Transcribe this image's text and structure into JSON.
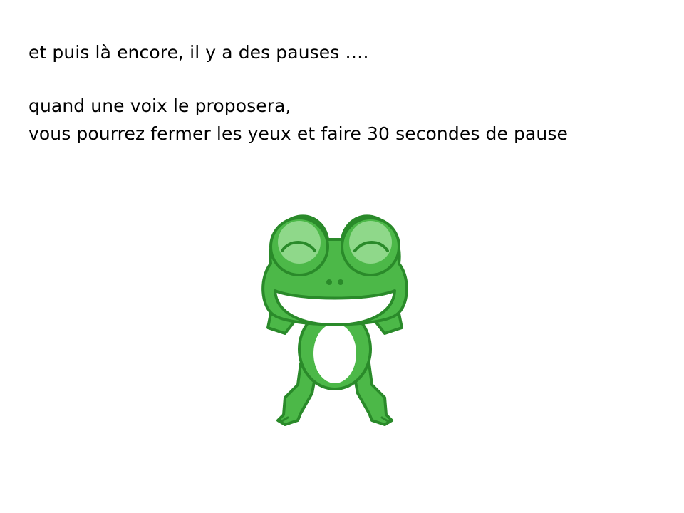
{
  "slide": {
    "line1": "et puis là encore, il y a des pauses ….",
    "line2": "quand une voix le proposera,",
    "line3": "vous pourrez fermer les yeux et faire 30 secondes de pause"
  },
  "illustration": {
    "subject": "frog-icon",
    "colors": {
      "green": "#4cb848",
      "dark_green": "#2a8a2a",
      "light_green": "#8fd88a",
      "white": "#ffffff"
    }
  }
}
